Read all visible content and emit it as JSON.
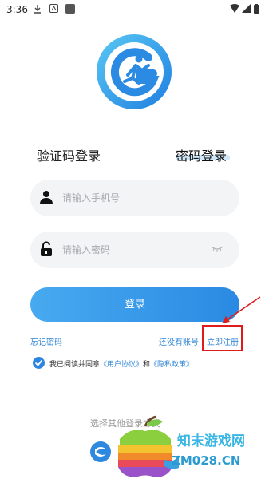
{
  "status_bar": {
    "time": "3:36"
  },
  "tabs": {
    "sms_login": "验证码登录",
    "password_login": "密码登录"
  },
  "phone_field": {
    "placeholder": "请输入手机号"
  },
  "password_field": {
    "placeholder": "请输入密码"
  },
  "login_button": "登录",
  "links": {
    "forgot_password": "忘记密码",
    "no_account": "还没有账号",
    "register": "立即注册"
  },
  "agreement": {
    "prefix": "我已阅读并同意",
    "user_agreement": "《用户协议》",
    "and": "和",
    "privacy_policy": "《隐私政策》"
  },
  "other_login": "选择其他登录方式",
  "watermark": {
    "site_name": "知末游戏网",
    "site_url": "ZM028.CN"
  },
  "colors": {
    "accent": "#2f85d6",
    "button": "#2a8ae3",
    "highlight": "#e01b1b"
  }
}
